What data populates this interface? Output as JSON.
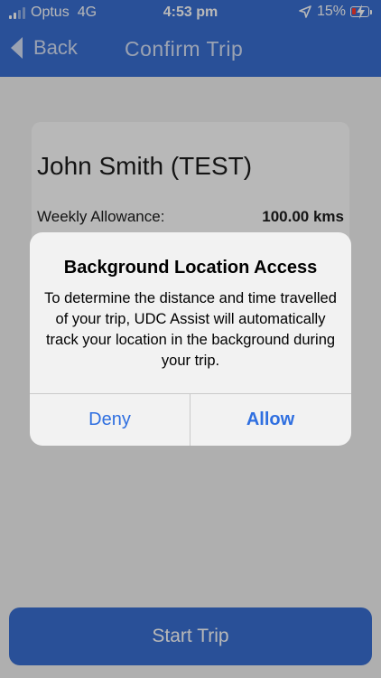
{
  "status_bar": {
    "carrier": "Optus",
    "network": "4G",
    "time": "4:53 pm",
    "battery_percent": "15%"
  },
  "nav": {
    "back_label": "Back",
    "title": "Confirm Trip"
  },
  "trip": {
    "passenger_name": "John Smith (TEST)",
    "allowance_label": "Weekly Allowance:",
    "allowance_value": "100.00 kms",
    "start_button_label": "Start Trip"
  },
  "alert": {
    "title": "Background Location Access",
    "message": "To determine the distance and time travelled of your trip, UDC Assist will automatically track your location in the background during your trip.",
    "deny_label": "Deny",
    "allow_label": "Allow"
  },
  "colors": {
    "accent": "#3a6fd3",
    "alert_button_text": "#2f6fe0",
    "battery_low": "#ff3b30"
  },
  "icons": {
    "signal": "cellular-signal-icon",
    "location": "location-arrow-icon",
    "battery": "battery-charging-icon",
    "back": "chevron-left-icon"
  }
}
